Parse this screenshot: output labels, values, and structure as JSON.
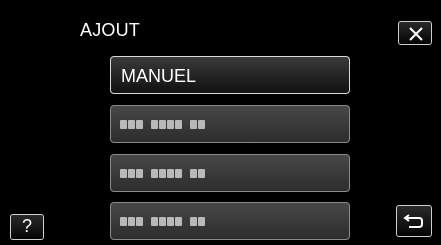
{
  "header": {
    "title": "AJOUT",
    "close_icon": "close-icon"
  },
  "menu": {
    "items": [
      {
        "label": "MANUEL",
        "selected": true
      },
      {
        "label": "",
        "placeholder": true
      },
      {
        "label": "",
        "placeholder": true
      },
      {
        "label": "",
        "placeholder": true
      }
    ]
  },
  "footer": {
    "help_label": "?",
    "back_icon": "return-icon"
  },
  "colors": {
    "background": "#000000",
    "text": "#ffffff",
    "button_border": "#cfcfcf"
  }
}
